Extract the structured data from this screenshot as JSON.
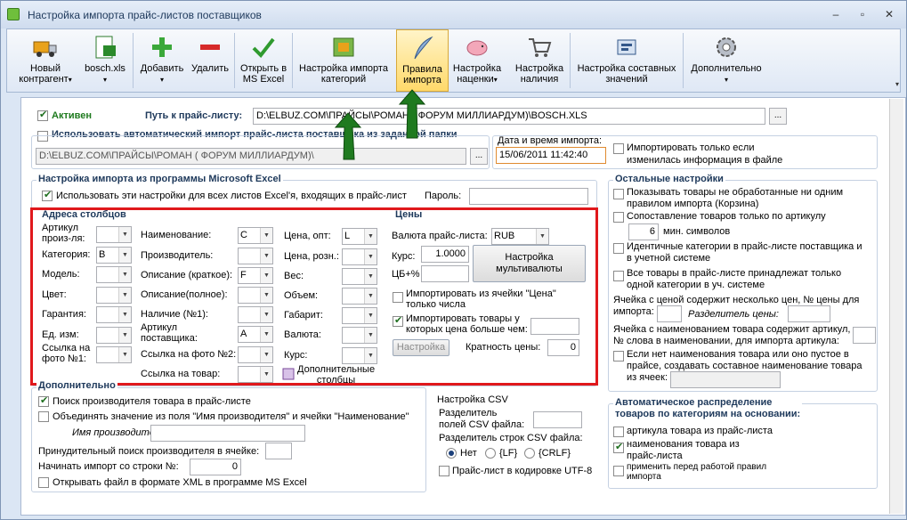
{
  "window": {
    "title": "Настройка импорта прайс-листов поставщиков",
    "btn_min": "–",
    "btn_max": "▫",
    "btn_close": "✕"
  },
  "toolbar": {
    "new": "Новый",
    "new2": "контрагент",
    "file": "bosch.xls",
    "add": "Добавить",
    "del": "Удалить",
    "open1": "Открыть в",
    "open2": "MS Excel",
    "cat1": "Настройка импорта",
    "cat2": "категорий",
    "rules1": "Правила",
    "rules2": "импорта",
    "mark1": "Настройка",
    "mark2": "наценки",
    "avail1": "Настройка",
    "avail2": "наличия",
    "comp1": "Настройка составных",
    "comp2": "значений",
    "more": "Дополнительно",
    "dd": "▾",
    "more_arrow": "▾"
  },
  "top": {
    "active": "Активен",
    "path_label": "Путь к прайс-листу:",
    "path_value": "D:\\ELBUZ.COM\\ПРАЙСЫ\\РОМАН ( ФОРУМ МИЛЛИАРДУМ)\\BOSCH.XLS",
    "browse": "...",
    "auto": "Использовать автоматический импорт прайс-листа поставщика из заданной папки",
    "folder": "D:\\ELBUZ.COM\\ПРАЙСЫ\\РОМАН ( ФОРУМ МИЛЛИАРДУМ)\\",
    "dt_label": "Дата и время импорта:",
    "dt_value": "15/06/2011 11:42:40",
    "only_changed1": "Импортировать только если",
    "only_changed2": "изменилась информация в файле"
  },
  "excel": {
    "title": "Настройка импорта из программы Microsoft Excel",
    "all_sheets": "Использовать эти настройки для всех листов Excel'я, входящих в прайс-лист",
    "password": "Пароль:",
    "cols_title": "Адреса столбцов",
    "prices_title": "Цены",
    "col1": [
      {
        "l1": "Артикул",
        "l2": "произ-ля:",
        "v": ""
      },
      {
        "l1": "Категория:",
        "l2": "",
        "v": "B"
      },
      {
        "l1": "Модель:",
        "l2": "",
        "v": ""
      },
      {
        "l1": "Цвет:",
        "l2": "",
        "v": ""
      },
      {
        "l1": "Гарантия:",
        "l2": "",
        "v": ""
      },
      {
        "l1": "Ед. изм:",
        "l2": "",
        "v": ""
      },
      {
        "l1": "Ссылка на",
        "l2": "фото №1:",
        "v": ""
      }
    ],
    "col2": [
      {
        "l1": "Наименование:",
        "l2": "",
        "v": "C"
      },
      {
        "l1": "Производитель:",
        "l2": "",
        "v": ""
      },
      {
        "l1": "Описание (краткое):",
        "l2": "",
        "v": "F"
      },
      {
        "l1": "Описание(полное):",
        "l2": "",
        "v": ""
      },
      {
        "l1": "Наличие (№1):",
        "l2": "",
        "v": ""
      },
      {
        "l1": "Артикул",
        "l2": "поставщика:",
        "v": "A"
      },
      {
        "l1": "Ссылка на фото №2:",
        "l2": "",
        "v": ""
      },
      {
        "l1": "Ссылка на товар:",
        "l2": "",
        "v": ""
      }
    ],
    "col3": [
      {
        "l1": "Цена, опт:",
        "v": "L"
      },
      {
        "l1": "Цена, розн.:",
        "v": ""
      },
      {
        "l1": "Вес:",
        "v": ""
      },
      {
        "l1": "Объем:",
        "v": ""
      },
      {
        "l1": "Габарит:",
        "v": ""
      },
      {
        "l1": "Валюта:",
        "v": ""
      },
      {
        "l1": "Курс:",
        "v": ""
      }
    ],
    "extra_cols": "Дополнительные",
    "extra_cols2": "столбцы",
    "currency_label": "Валюта прайс-листа:",
    "currency_value": "RUB",
    "rate_label": "Курс:",
    "rate_value": "1.0000",
    "cb_label": "ЦБ+%",
    "cb_value": "",
    "currency_btn1": "Настройка",
    "currency_btn2": "мультивалюты",
    "import_cell1": "Импортировать из ячейки \"Цена\"",
    "import_cell2": "только числа",
    "import_gt1": "Импортировать товары у",
    "import_gt2": "которых цена больше чем:",
    "settings_btn": "Настройка",
    "mult_label": "Кратность цены:",
    "mult_value": "0"
  },
  "extra": {
    "title": "Дополнительно",
    "find_maker": "Поиск производителя товара в прайс-листе",
    "merge": "Объединять значение из поля \"Имя производителя\" и ячейки \"Наименование\"",
    "maker_name": "Имя производителя:",
    "force": "Принудительный поиск производителя в ячейке:",
    "start_row": "Начинать импорт со строки №:",
    "start_row_value": "0",
    "xml": "Открывать файл в формате XML в программе MS Excel"
  },
  "csv": {
    "title": "Настройка CSV",
    "field_sep1": "Разделитель",
    "field_sep2": "полей CSV файла:",
    "row_sep": "Разделитель строк CSV файла:",
    "r_none": "Нет",
    "r_lf": "{LF}",
    "r_crlf": "{CRLF}",
    "utf8": "Прайс-лист в кодировке UTF-8"
  },
  "other": {
    "title": "Остальные настройки",
    "o1a": "Показывать товары не обработанные ни одним",
    "o1b": "правилом импорта (Корзина)",
    "o2": "Сопоставление товаров только по артикулу",
    "o2_value": "6",
    "o2_suffix": "мин. символов",
    "o3a": "Идентичные категории в прайс-листе поставщика и",
    "o3b": "в учетной системе",
    "o4a": "Все товары в прайс-листе принадлежат только",
    "o4b": "одной категории в уч. системе",
    "cell_multi1": "Ячейка с ценой содержит несколько цен, № цены для",
    "cell_multi2": "импорта:",
    "price_sep": "Разделитель цены:",
    "cell_art1": "Ячейка с наименованием товара содержит артикул,",
    "cell_art2": "№ слова в наименовании, для импорта артикула:",
    "o5a": "Если нет наименования товара или оно пустое в",
    "o5b": "прайсе, создавать составное наименование товара",
    "o5c": "из ячеек:"
  },
  "auto": {
    "title1": "Автоматическое распределение",
    "title2": "товаров по категориям на основании:",
    "a1": "артикула товара из прайс-листа",
    "a2a": "наименования товара из",
    "a2b": "прайс-листа",
    "a3a": "применить перед работой правил",
    "a3b": "импорта"
  },
  "colors": {
    "accent": "#1e395b",
    "highlight": "#e0181c",
    "arrow": "#1f7a1f"
  }
}
